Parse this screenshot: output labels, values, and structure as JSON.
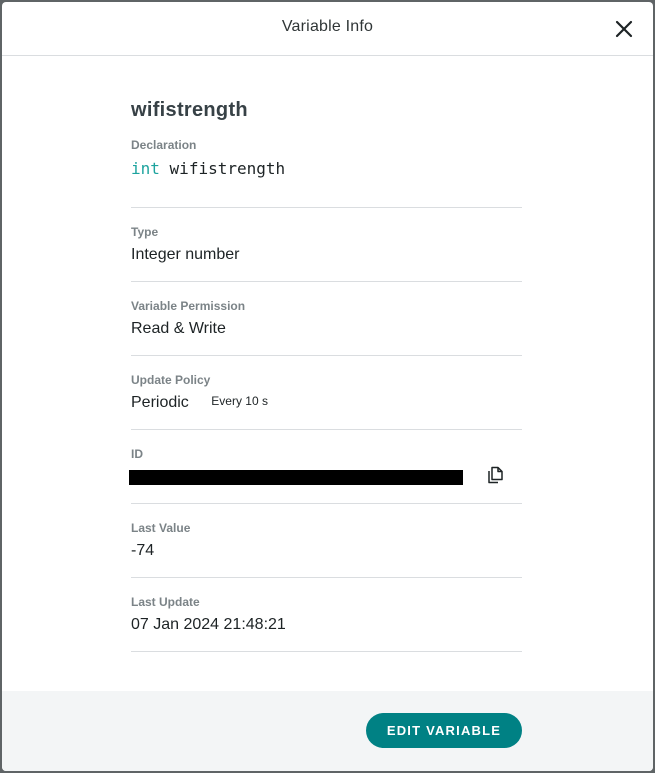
{
  "modal": {
    "title": "Variable Info",
    "close_icon": "close-icon"
  },
  "variable": {
    "name": "wifistrength",
    "declaration": {
      "label": "Declaration",
      "keyword": "int",
      "identifier": "wifistrength"
    },
    "type": {
      "label": "Type",
      "value": "Integer number"
    },
    "permission": {
      "label": "Variable Permission",
      "value": "Read & Write"
    },
    "update_policy": {
      "label": "Update Policy",
      "value": "Periodic",
      "interval": "Every 10 s"
    },
    "id": {
      "label": "ID",
      "copy_icon": "copy-icon"
    },
    "last_value": {
      "label": "Last Value",
      "value": "-74"
    },
    "last_update": {
      "label": "Last Update",
      "value": "07 Jan 2024 21:48:21"
    }
  },
  "footer": {
    "edit_label": "EDIT VARIABLE"
  },
  "colors": {
    "accent": "#008184",
    "keyword": "#1da39e",
    "label": "#7b8387",
    "text": "#1d2325"
  }
}
